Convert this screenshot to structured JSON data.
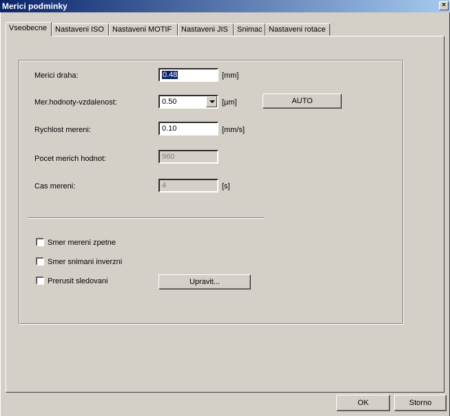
{
  "window": {
    "title": "Merici podminky",
    "close_glyph": "×"
  },
  "tabs": [
    {
      "label": "Vseobecne",
      "active": true
    },
    {
      "label": "Nastaveni ISO",
      "active": false
    },
    {
      "label": "Nastaveni MOTIF",
      "active": false
    },
    {
      "label": "Nastaveni JIS",
      "active": false
    },
    {
      "label": "Snimac",
      "active": false
    },
    {
      "label": "Nastaveni rotace",
      "active": false
    }
  ],
  "fields": {
    "merici_draha": {
      "label": "Merici draha:",
      "value": "0.48",
      "unit": "[mm]"
    },
    "mer_hodnoty": {
      "label": "Mer.hodnoty-vzdalenost:",
      "value": "0.50",
      "unit": "[µm]"
    },
    "rychlost": {
      "label": "Rychlost mereni:",
      "value": "0.10",
      "unit": "[mm/s]"
    },
    "pocet": {
      "label": "Pocet merich hodnot:",
      "value": "960"
    },
    "cas": {
      "label": "Cas mereni:",
      "value": "4",
      "unit": "[s]"
    }
  },
  "buttons": {
    "auto": "AUTO",
    "upravit": "Upravit...",
    "ok": "OK",
    "storno": "Storno"
  },
  "checkboxes": [
    {
      "label": "Smer mereni zpetne",
      "checked": false
    },
    {
      "label": "Smer snimani inverzni",
      "checked": false
    },
    {
      "label": "Prerusit sledovani",
      "checked": false
    }
  ]
}
